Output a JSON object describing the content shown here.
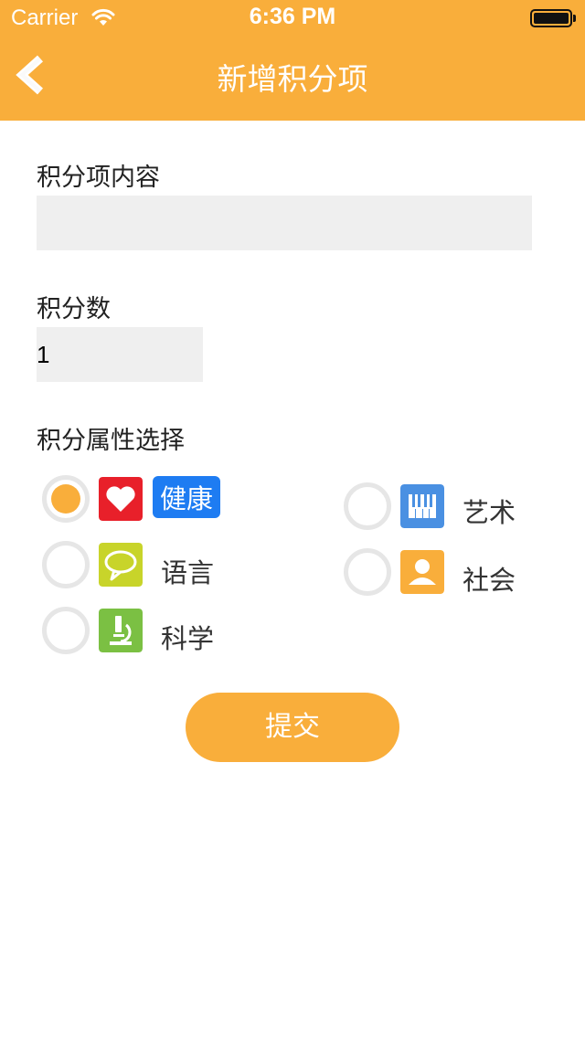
{
  "status_bar": {
    "carrier": "Carrier",
    "time": "6:36 PM"
  },
  "nav": {
    "title": "新增积分项",
    "back_icon": "chevron-left-icon"
  },
  "form": {
    "content_label": "积分项内容",
    "content_value": "",
    "score_label": "积分数",
    "score_value": "1",
    "attr_label": "积分属性选择"
  },
  "options": [
    {
      "label": "健康",
      "icon": "heart-icon",
      "color": "#E8202A",
      "selected": true
    },
    {
      "label": "艺术",
      "icon": "piano-icon",
      "color": "#4A90E2",
      "selected": false
    },
    {
      "label": "语言",
      "icon": "speech-bubble-icon",
      "color": "#C8D42A",
      "selected": false
    },
    {
      "label": "社会",
      "icon": "person-icon",
      "color": "#F9AE3B",
      "selected": false
    },
    {
      "label": "科学",
      "icon": "microscope-icon",
      "color": "#7BC043",
      "selected": false
    }
  ],
  "submit_label": "提交",
  "colors": {
    "primary": "#F9AE3B",
    "selected_tag": "#1E7CF2",
    "field_bg": "#EFEFEF"
  }
}
